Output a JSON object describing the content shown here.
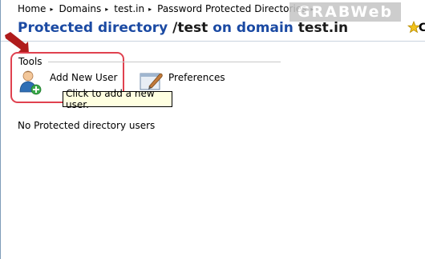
{
  "breadcrumb": {
    "items": [
      "Home",
      "Domains",
      "test.in",
      "Password Protected Directories"
    ],
    "separator": "▸"
  },
  "watermark": "GRABWeb",
  "title": {
    "part1": "Protected directory",
    "part2": " /test",
    "part3": " on domain",
    "part4": " test.in"
  },
  "title_clip": "C",
  "tools": {
    "label": "Tools",
    "add_user_label": "Add New User",
    "preferences_label": "Preferences",
    "tooltip": "Click to add a new user."
  },
  "empty_message": "No Protected directory users",
  "colors": {
    "title_blue": "#1b4aa3",
    "highlight_red": "#e0414f",
    "arrow": "#b01c1c",
    "tooltip_bg": "#ffffe1"
  },
  "icons": {
    "breadcrumb_separator": "triangle-right-icon",
    "add_user": "add-user-icon",
    "preferences": "preferences-icon",
    "favorite": "star-icon",
    "annotation": "red-arrow-icon"
  }
}
